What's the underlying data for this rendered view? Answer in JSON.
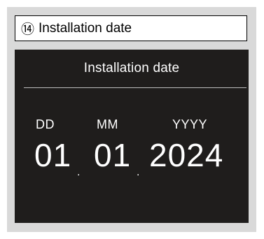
{
  "caption": {
    "number": "⑭",
    "text": "Installation date"
  },
  "screen": {
    "title": "Installation date",
    "labels": {
      "day": "DD",
      "month": "MM",
      "year": "YYYY"
    },
    "values": {
      "day": "01",
      "month": "01",
      "year": "2024"
    },
    "separator": "."
  }
}
